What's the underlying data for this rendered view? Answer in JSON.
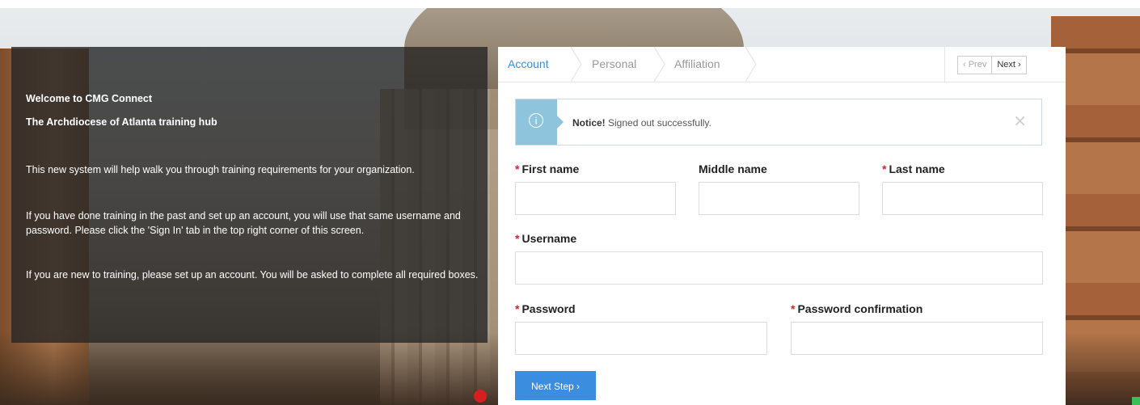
{
  "info": {
    "title": "Welcome to CMG Connect",
    "subtitle": "The Archdiocese of Atlanta training hub",
    "p1": "This new system will help walk you through training requirements for your organization.",
    "p2": "If you have done training in the past and set up an account, you will use that same username and password.  Please click the 'Sign In' tab in the top right corner of this screen.",
    "p3": "If you are new to training, please set up an account.  You will be asked to complete all required boxes."
  },
  "tabs": [
    {
      "label": "Account",
      "active": true
    },
    {
      "label": "Personal",
      "active": false
    },
    {
      "label": "Affiliation",
      "active": false
    }
  ],
  "pager": {
    "prev": "‹  Prev",
    "next": "Next  ›"
  },
  "notice": {
    "strong": "Notice!",
    "text": " Signed out successfully.",
    "icon": "info-icon",
    "close": "×"
  },
  "form": {
    "required_mark": "*",
    "first_name": {
      "label": "First name",
      "value": ""
    },
    "middle_name": {
      "label": "Middle name",
      "value": ""
    },
    "last_name": {
      "label": "Last name",
      "value": ""
    },
    "username": {
      "label": "Username",
      "value": ""
    },
    "password": {
      "label": "Password",
      "value": ""
    },
    "password_confirmation": {
      "label": "Password confirmation",
      "value": ""
    },
    "next_step": "Next Step  ›"
  },
  "colors": {
    "accent": "#3b8de0",
    "required": "#d9232d",
    "notice": "#8fc4dd"
  }
}
